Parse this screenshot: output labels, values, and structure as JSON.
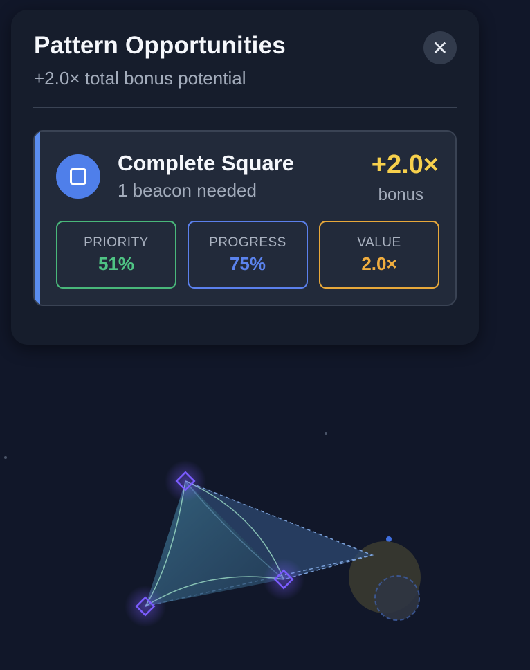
{
  "panel": {
    "title": "Pattern Opportunities",
    "subtitle": "+2.0× total bonus potential",
    "close_label": "✕"
  },
  "opportunity": {
    "name": "Complete Square",
    "requirement": "1 beacon needed",
    "bonus_value": "+2.0×",
    "bonus_label": "bonus",
    "stats": {
      "priority": {
        "label": "PRIORITY",
        "value": "51%"
      },
      "progress": {
        "label": "PROGRESS",
        "value": "75%"
      },
      "value": {
        "label": "VALUE",
        "value": "2.0×"
      }
    }
  },
  "colors": {
    "background": "#111729",
    "accent": "#5b8ef0",
    "bonus": "#f7d04c",
    "priority": "#4fc484",
    "progress": "#5b83ee",
    "value": "#f0ad3e"
  }
}
